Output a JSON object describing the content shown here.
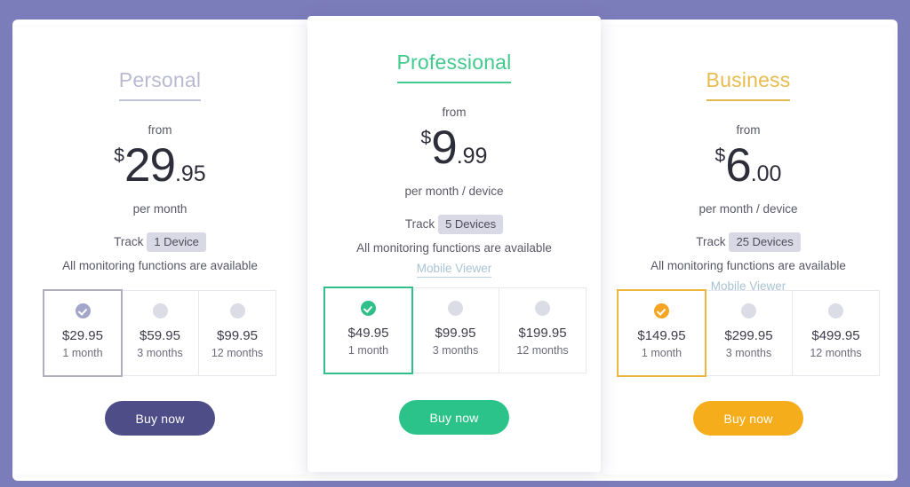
{
  "page": {
    "background_color": "#7b7cba",
    "panel_color": "#ffffff"
  },
  "plans": [
    {
      "id": "personal",
      "title": "Personal",
      "accent_color": "#b9bad1",
      "from_label": "from",
      "currency": "$",
      "price_whole": "29",
      "price_frac": ".95",
      "period": "per month",
      "track_label": "Track",
      "track_badge": "1 Device",
      "feature": "All monitoring functions are available",
      "mobile_viewer": "",
      "buy_label": "Buy now",
      "options": [
        {
          "price": "$29.95",
          "term": "1 month",
          "selected": true
        },
        {
          "price": "$59.95",
          "term": "3 months",
          "selected": false
        },
        {
          "price": "$99.95",
          "term": "12 months",
          "selected": false
        }
      ]
    },
    {
      "id": "professional",
      "title": "Professional",
      "accent_color": "#42c98d",
      "from_label": "from",
      "currency": "$",
      "price_whole": "9",
      "price_frac": ".99",
      "period": "per month / device",
      "track_label": "Track",
      "track_badge": "5 Devices",
      "feature": "All monitoring functions are available",
      "mobile_viewer": "Mobile Viewer",
      "buy_label": "Buy now",
      "options": [
        {
          "price": "$49.95",
          "term": "1 month",
          "selected": true
        },
        {
          "price": "$99.95",
          "term": "3 months",
          "selected": false
        },
        {
          "price": "$199.95",
          "term": "12 months",
          "selected": false
        }
      ]
    },
    {
      "id": "business",
      "title": "Business",
      "accent_color": "#e8bb4e",
      "from_label": "from",
      "currency": "$",
      "price_whole": "6",
      "price_frac": ".00",
      "period": "per month / device",
      "track_label": "Track",
      "track_badge": "25 Devices",
      "feature": "All monitoring functions are available",
      "mobile_viewer": "Mobile Viewer",
      "buy_label": "Buy now",
      "options": [
        {
          "price": "$149.95",
          "term": "1 month",
          "selected": true
        },
        {
          "price": "$299.95",
          "term": "3 months",
          "selected": false
        },
        {
          "price": "$499.95",
          "term": "12 months",
          "selected": false
        }
      ]
    }
  ]
}
